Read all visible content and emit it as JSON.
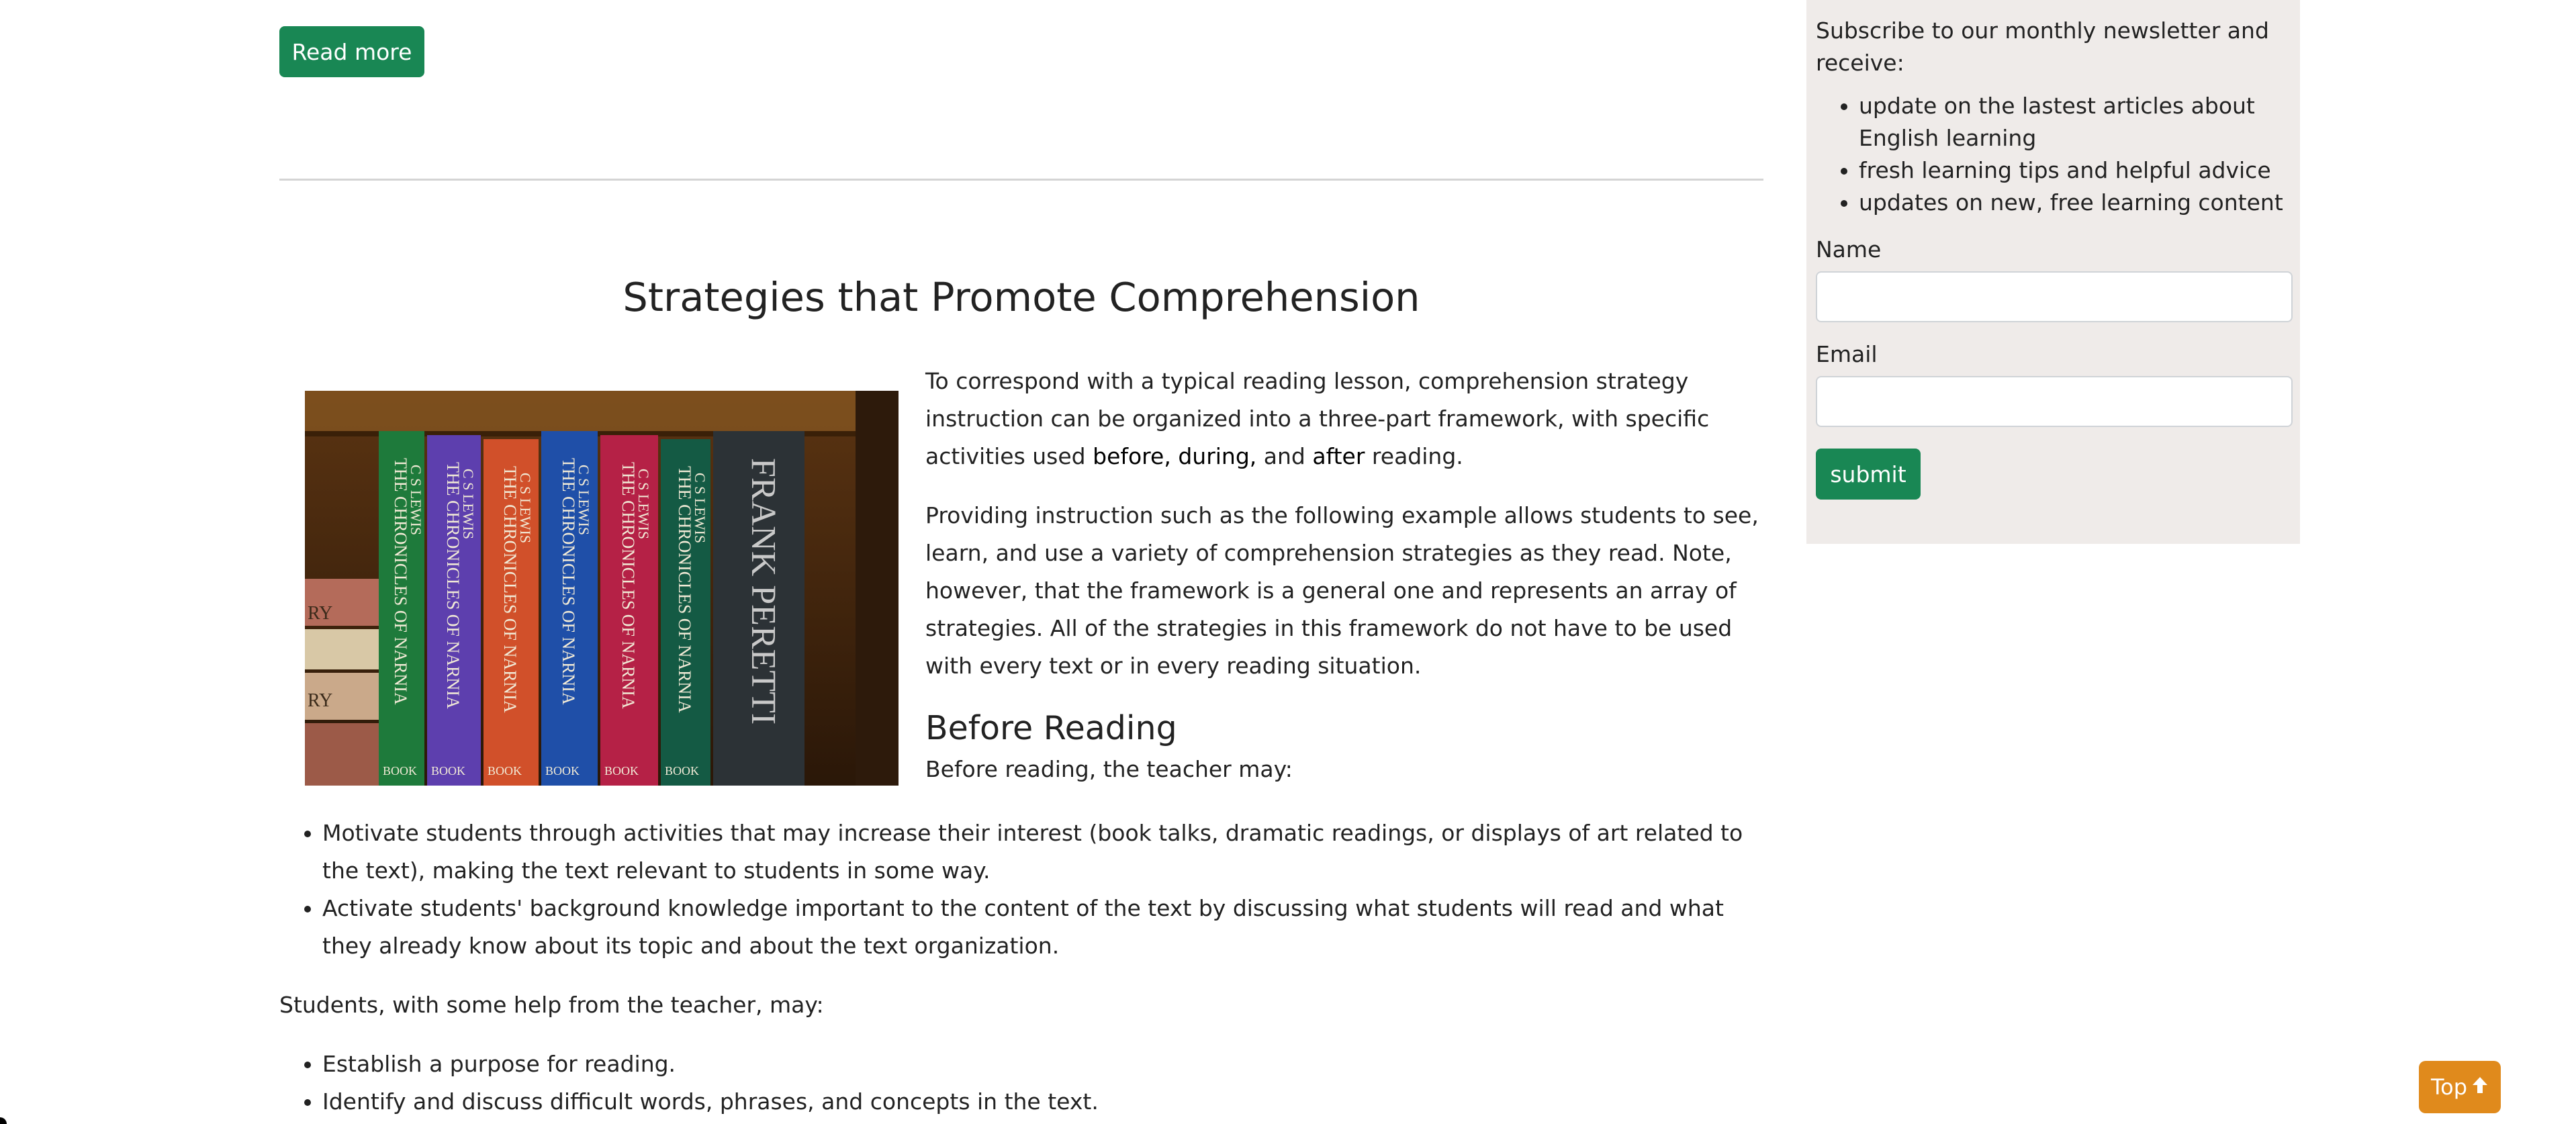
{
  "main": {
    "read_more_label": "Read more",
    "article_title": "Strategies that Promote Comprehension",
    "book_image": {
      "spines": [
        {
          "text": "THE CHRONICLES OF NARNIA",
          "author": "C S LEWIS",
          "color": "#1e7a3b"
        },
        {
          "text": "THE CHRONICLES OF NARNIA",
          "author": "C S LEWIS",
          "color": "#5d3fae"
        },
        {
          "text": "THE CHRONICLES OF NARNIA",
          "author": "C S LEWIS",
          "color": "#d1502a"
        },
        {
          "text": "THE CHRONICLES OF NARNIA",
          "author": "C S LEWIS",
          "color": "#1f4fa8"
        },
        {
          "text": "THE CHRONICLES OF NARNIA",
          "author": "C S LEWIS",
          "color": "#b52146"
        },
        {
          "text": "THE CHRONICLES OF NARNIA",
          "author": "C S LEWIS",
          "color": "#145a44"
        },
        {
          "text": "FRANK PERETTI",
          "author": "",
          "color": "#2c3236"
        }
      ],
      "shelf_labels": [
        "RY",
        "RY"
      ],
      "spine_footer": "BOOK"
    },
    "intro_p1": {
      "part1": "To correspond with a typical reading lesson, comprehension strategy instruction can be organized into a three-part framework, with specific activities used ",
      "before": "before,",
      "sep1": " ",
      "during": "during,",
      "sep2": " and ",
      "after": "after",
      "part2": " reading."
    },
    "intro_p2": "Providing instruction such as the following example allows students to see, learn, and use a variety of comprehension strategies as they read. Note, however, that the framework is a general one and represents an array of strategies. All of the strategies in this framework do not have to be used with every text or in every reading situation.",
    "before_reading_heading": "Before Reading",
    "before_reading_intro": "Before reading, the teacher may:",
    "teacher_items": [
      "Motivate students through activities that may increase their interest (book talks, dramatic readings, or displays of art related to the text), making the text relevant to students in some way.",
      "Activate students' background knowledge important to the content of the text by discussing what students will read and what they already know about its topic and about the text organization."
    ],
    "students_intro": "Students, with some help from the teacher, may:",
    "student_items": [
      "Establish a purpose for reading.",
      "Identify and discuss difficult words, phrases, and concepts in the text."
    ]
  },
  "sidebar": {
    "intro": "Subscribe to our monthly newsletter and receive:",
    "benefits": [
      "update on the lastest articles about English learning",
      "fresh learning tips and helpful advice",
      "updates on new, free learning content"
    ],
    "name_label": "Name",
    "name_value": "",
    "email_label": "Email",
    "email_value": "",
    "submit_label": "submit"
  },
  "top_button": {
    "label": "Top",
    "icon": "arrow-up-icon"
  },
  "colors": {
    "green": "#198754",
    "orange": "#e08a1c",
    "sidebar_bg": "#efebe9"
  }
}
